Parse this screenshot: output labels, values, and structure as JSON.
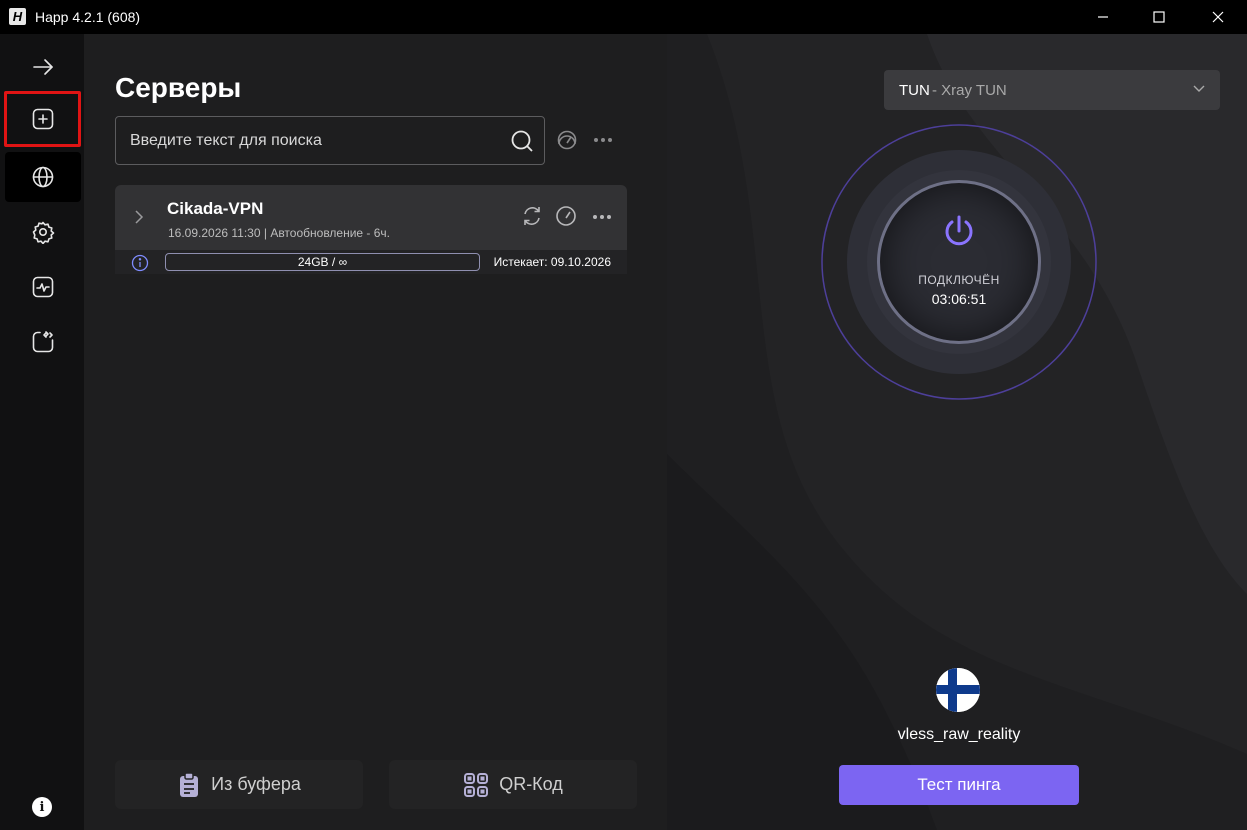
{
  "window": {
    "title": "Happ 4.2.1 (608)",
    "logo_letter": "H"
  },
  "sidebar": {
    "items": [
      {
        "name": "arrow-right-icon",
        "label": "Collapse"
      },
      {
        "name": "add-icon",
        "label": "Add"
      },
      {
        "name": "globe-icon",
        "label": "Servers"
      },
      {
        "name": "gear-icon",
        "label": "Settings"
      },
      {
        "name": "activity-icon",
        "label": "Statistics"
      },
      {
        "name": "code-icon",
        "label": "Routing"
      }
    ],
    "info_label": "i",
    "accent_color": "#7c5cff",
    "highlight_color": "#e01414"
  },
  "main": {
    "title": "Серверы",
    "search": {
      "placeholder": "Введите текст для поиска",
      "value": ""
    },
    "subscription": {
      "name": "Cikada-VPN",
      "meta": "16.09.2026 11:30 | Автообновление - 6ч.",
      "traffic": "24GB / ∞",
      "expires": "Истекает: 09.10.2026"
    },
    "buttons": {
      "clipboard": "Из буфера",
      "qr": "QR-Код"
    }
  },
  "right": {
    "mode": {
      "key": "TUN",
      "value": "- Xray TUN"
    },
    "status": "ПОДКЛЮЧЁН",
    "timer": "03:06:51",
    "server_name": "vless_raw_reality",
    "flag": "finland",
    "ping_button": "Тест пинга",
    "accent_color": "#7c65f2"
  }
}
